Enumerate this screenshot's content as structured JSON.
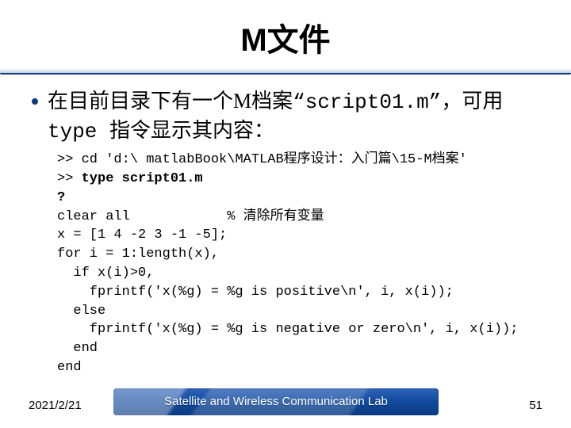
{
  "title": "M文件",
  "bullet": {
    "line1_prefix": "在目前目录下有一个M档案",
    "quoted_file": "“script01.m”",
    "line1_suffix": "，可用",
    "line2": "type 指令显示其内容："
  },
  "code": {
    "l01a": ">> cd '",
    "l01b": "d:\\ matlabBook\\MATLAB程序设计：入门篇\\15-M档案'",
    "l02a": ">> ",
    "l02b": "type script01.m",
    "l03": "?",
    "l04": "clear all            % 清除所有变量",
    "l05": "x = [1 4 -2 3 -1 -5];",
    "l06": "for i = 1:length(x),",
    "l07": "  if x(i)>0,",
    "l08": "    fprintf('x(%g) = %g is positive\\n', i, x(i));",
    "l09": "  else",
    "l10": "    fprintf('x(%g) = %g is negative or zero\\n', i, x(i));",
    "l11": "  end",
    "l12": "end"
  },
  "footer": {
    "date": "2021/2/21",
    "lab": "Satellite and Wireless Communication Lab",
    "page": "51"
  }
}
